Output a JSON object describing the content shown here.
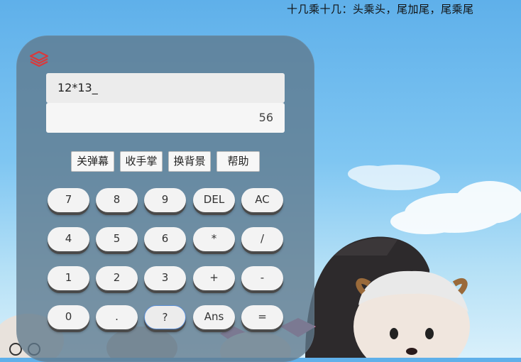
{
  "banner": {
    "text": "十几乘十几：头乘头，尾加尾，尾乘尾"
  },
  "display": {
    "expression": "12*13_",
    "result": "56"
  },
  "toolbar": [
    {
      "label": "关弹幕"
    },
    {
      "label": "收手掌"
    },
    {
      "label": "换背景"
    },
    {
      "label": "帮助"
    }
  ],
  "keys": [
    [
      "7",
      "8",
      "9",
      "DEL",
      "AC"
    ],
    [
      "4",
      "5",
      "6",
      "*",
      "/"
    ],
    [
      "1",
      "2",
      "3",
      "+",
      "-"
    ],
    [
      "0",
      ".",
      "?",
      "Ans",
      "="
    ]
  ],
  "colors": {
    "accent": "#d9393b",
    "panel": "#5f788c",
    "sky_top": "#5fb0ea"
  },
  "icons": {
    "layers": "layers-icon"
  }
}
